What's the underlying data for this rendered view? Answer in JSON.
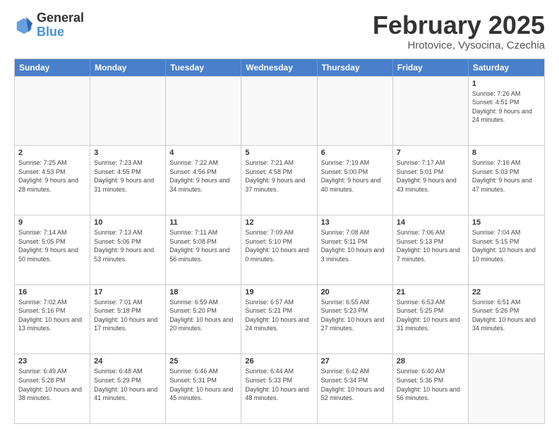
{
  "logo": {
    "general": "General",
    "blue": "Blue"
  },
  "header": {
    "title": "February 2025",
    "subtitle": "Hrotovice, Vysocina, Czechia"
  },
  "days_of_week": [
    "Sunday",
    "Monday",
    "Tuesday",
    "Wednesday",
    "Thursday",
    "Friday",
    "Saturday"
  ],
  "weeks": [
    [
      {
        "day": "",
        "info": ""
      },
      {
        "day": "",
        "info": ""
      },
      {
        "day": "",
        "info": ""
      },
      {
        "day": "",
        "info": ""
      },
      {
        "day": "",
        "info": ""
      },
      {
        "day": "",
        "info": ""
      },
      {
        "day": "1",
        "info": "Sunrise: 7:26 AM\nSunset: 4:51 PM\nDaylight: 9 hours and 24 minutes."
      }
    ],
    [
      {
        "day": "2",
        "info": "Sunrise: 7:25 AM\nSunset: 4:53 PM\nDaylight: 9 hours and 28 minutes."
      },
      {
        "day": "3",
        "info": "Sunrise: 7:23 AM\nSunset: 4:55 PM\nDaylight: 9 hours and 31 minutes."
      },
      {
        "day": "4",
        "info": "Sunrise: 7:22 AM\nSunset: 4:56 PM\nDaylight: 9 hours and 34 minutes."
      },
      {
        "day": "5",
        "info": "Sunrise: 7:21 AM\nSunset: 4:58 PM\nDaylight: 9 hours and 37 minutes."
      },
      {
        "day": "6",
        "info": "Sunrise: 7:19 AM\nSunset: 5:00 PM\nDaylight: 9 hours and 40 minutes."
      },
      {
        "day": "7",
        "info": "Sunrise: 7:17 AM\nSunset: 5:01 PM\nDaylight: 9 hours and 43 minutes."
      },
      {
        "day": "8",
        "info": "Sunrise: 7:16 AM\nSunset: 5:03 PM\nDaylight: 9 hours and 47 minutes."
      }
    ],
    [
      {
        "day": "9",
        "info": "Sunrise: 7:14 AM\nSunset: 5:05 PM\nDaylight: 9 hours and 50 minutes."
      },
      {
        "day": "10",
        "info": "Sunrise: 7:13 AM\nSunset: 5:06 PM\nDaylight: 9 hours and 53 minutes."
      },
      {
        "day": "11",
        "info": "Sunrise: 7:11 AM\nSunset: 5:08 PM\nDaylight: 9 hours and 56 minutes."
      },
      {
        "day": "12",
        "info": "Sunrise: 7:09 AM\nSunset: 5:10 PM\nDaylight: 10 hours and 0 minutes."
      },
      {
        "day": "13",
        "info": "Sunrise: 7:08 AM\nSunset: 5:11 PM\nDaylight: 10 hours and 3 minutes."
      },
      {
        "day": "14",
        "info": "Sunrise: 7:06 AM\nSunset: 5:13 PM\nDaylight: 10 hours and 7 minutes."
      },
      {
        "day": "15",
        "info": "Sunrise: 7:04 AM\nSunset: 5:15 PM\nDaylight: 10 hours and 10 minutes."
      }
    ],
    [
      {
        "day": "16",
        "info": "Sunrise: 7:02 AM\nSunset: 5:16 PM\nDaylight: 10 hours and 13 minutes."
      },
      {
        "day": "17",
        "info": "Sunrise: 7:01 AM\nSunset: 5:18 PM\nDaylight: 10 hours and 17 minutes."
      },
      {
        "day": "18",
        "info": "Sunrise: 6:59 AM\nSunset: 5:20 PM\nDaylight: 10 hours and 20 minutes."
      },
      {
        "day": "19",
        "info": "Sunrise: 6:57 AM\nSunset: 5:21 PM\nDaylight: 10 hours and 24 minutes."
      },
      {
        "day": "20",
        "info": "Sunrise: 6:55 AM\nSunset: 5:23 PM\nDaylight: 10 hours and 27 minutes."
      },
      {
        "day": "21",
        "info": "Sunrise: 6:53 AM\nSunset: 5:25 PM\nDaylight: 10 hours and 31 minutes."
      },
      {
        "day": "22",
        "info": "Sunrise: 6:51 AM\nSunset: 5:26 PM\nDaylight: 10 hours and 34 minutes."
      }
    ],
    [
      {
        "day": "23",
        "info": "Sunrise: 6:49 AM\nSunset: 5:28 PM\nDaylight: 10 hours and 38 minutes."
      },
      {
        "day": "24",
        "info": "Sunrise: 6:48 AM\nSunset: 5:29 PM\nDaylight: 10 hours and 41 minutes."
      },
      {
        "day": "25",
        "info": "Sunrise: 6:46 AM\nSunset: 5:31 PM\nDaylight: 10 hours and 45 minutes."
      },
      {
        "day": "26",
        "info": "Sunrise: 6:44 AM\nSunset: 5:33 PM\nDaylight: 10 hours and 48 minutes."
      },
      {
        "day": "27",
        "info": "Sunrise: 6:42 AM\nSunset: 5:34 PM\nDaylight: 10 hours and 52 minutes."
      },
      {
        "day": "28",
        "info": "Sunrise: 6:40 AM\nSunset: 5:36 PM\nDaylight: 10 hours and 56 minutes."
      },
      {
        "day": "",
        "info": ""
      }
    ]
  ]
}
